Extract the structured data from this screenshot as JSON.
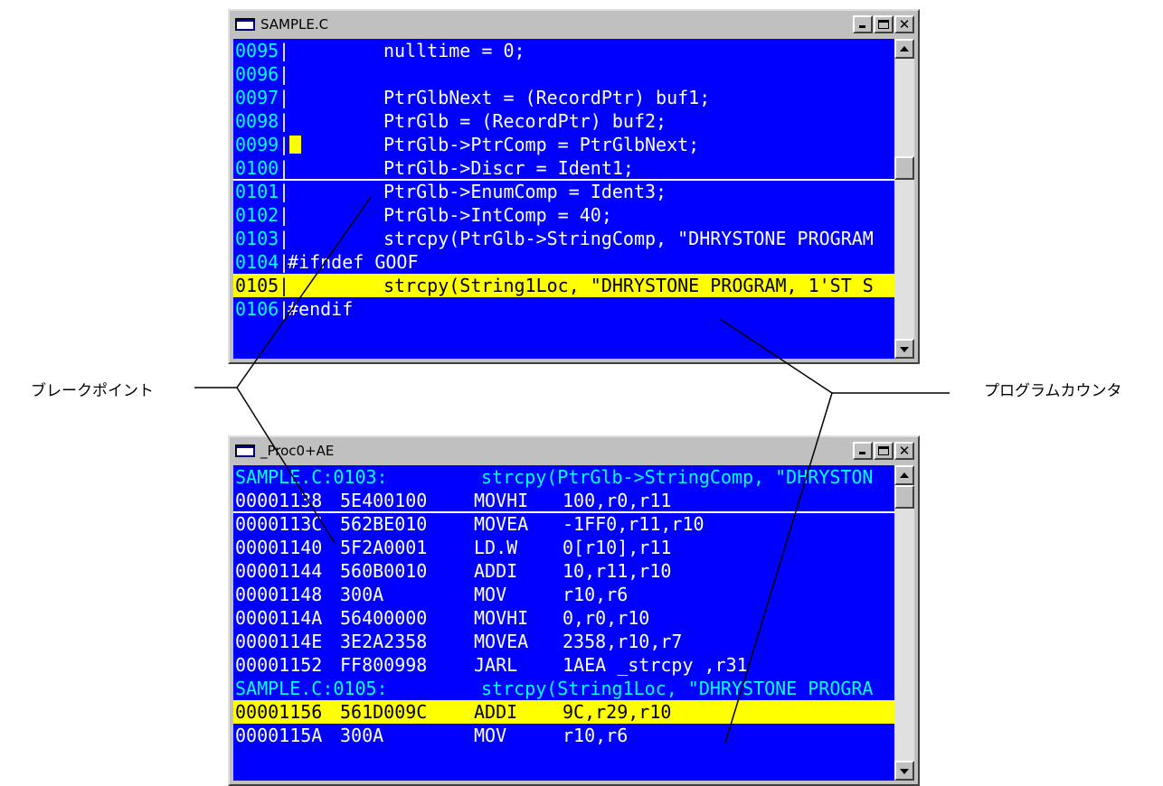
{
  "source_window": {
    "title": "SAMPLE.C",
    "lines": [
      {
        "no": "0095",
        "code": "nulltime = 0;"
      },
      {
        "no": "0096",
        "code": ""
      },
      {
        "no": "0097",
        "code": "PtrGlbNext = (RecordPtr) buf1;"
      },
      {
        "no": "0098",
        "code": "PtrGlb = (RecordPtr) buf2;"
      },
      {
        "no": "0099",
        "code": "PtrGlb->PtrComp = PtrGlbNext;"
      },
      {
        "no": "0100",
        "code": "PtrGlb->Discr = Ident1;"
      },
      {
        "no": "0101",
        "code": "PtrGlb->EnumComp = Ident3;"
      },
      {
        "no": "0102",
        "code": "PtrGlb->IntComp = 40;"
      },
      {
        "no": "0103",
        "code": "strcpy(PtrGlb->StringComp, \"DHRYSTONE PROGRAM"
      },
      {
        "no": "0104",
        "code": "#ifndef GOOF"
      },
      {
        "no": "0105",
        "code": "strcpy(String1Loc, \"DHRYSTONE PROGRAM, 1'ST S"
      },
      {
        "no": "0106",
        "code": "#endif"
      }
    ]
  },
  "asm_window": {
    "title": "_Proc0+AE",
    "rows": [
      {
        "kind": "src",
        "ref": "SAMPLE.C:0103:",
        "text": "strcpy(PtrGlb->StringComp, \"DHRYSTON"
      },
      {
        "kind": "asm",
        "addr": "00001138",
        "hex": "5E400100",
        "op": "MOVHI",
        "args": "100,r0,r11"
      },
      {
        "kind": "asm",
        "addr": "0000113C",
        "hex": "562BE010",
        "op": "MOVEA",
        "args": "-1FF0,r11,r10"
      },
      {
        "kind": "asm",
        "addr": "00001140",
        "hex": "5F2A0001",
        "op": "LD.W",
        "args": "0[r10],r11"
      },
      {
        "kind": "asm",
        "addr": "00001144",
        "hex": "560B0010",
        "op": "ADDI",
        "args": "10,r11,r10"
      },
      {
        "kind": "asm",
        "addr": "00001148",
        "hex": "300A",
        "op": "MOV",
        "args": "r10,r6"
      },
      {
        "kind": "asm",
        "addr": "0000114A",
        "hex": "56400000",
        "op": "MOVHI",
        "args": "0,r0,r10"
      },
      {
        "kind": "asm",
        "addr": "0000114E",
        "hex": "3E2A2358",
        "op": "MOVEA",
        "args": "2358,r10,r7"
      },
      {
        "kind": "asm",
        "addr": "00001152",
        "hex": "FF800998",
        "op": "JARL",
        "args": "1AEA _strcpy ,r31"
      },
      {
        "kind": "src",
        "ref": "SAMPLE.C:0105:",
        "text": "strcpy(String1Loc, \"DHRYSTONE PROGRA"
      },
      {
        "kind": "asm",
        "addr": "00001156",
        "hex": "561D009C",
        "op": "ADDI",
        "args": "9C,r29,r10"
      },
      {
        "kind": "asm",
        "addr": "0000115A",
        "hex": "300A",
        "op": "MOV",
        "args": "r10,r6"
      }
    ]
  },
  "annotations": {
    "breakpoint": "ブレークポイント",
    "program_counter": "プログラムカウンタ"
  },
  "colors": {
    "window_bg": "#0000ff",
    "line_number": "#00ffff",
    "code_text": "#ffffff",
    "pc_highlight": "#ffff00",
    "breakpoint_marker": "#ffff00"
  }
}
